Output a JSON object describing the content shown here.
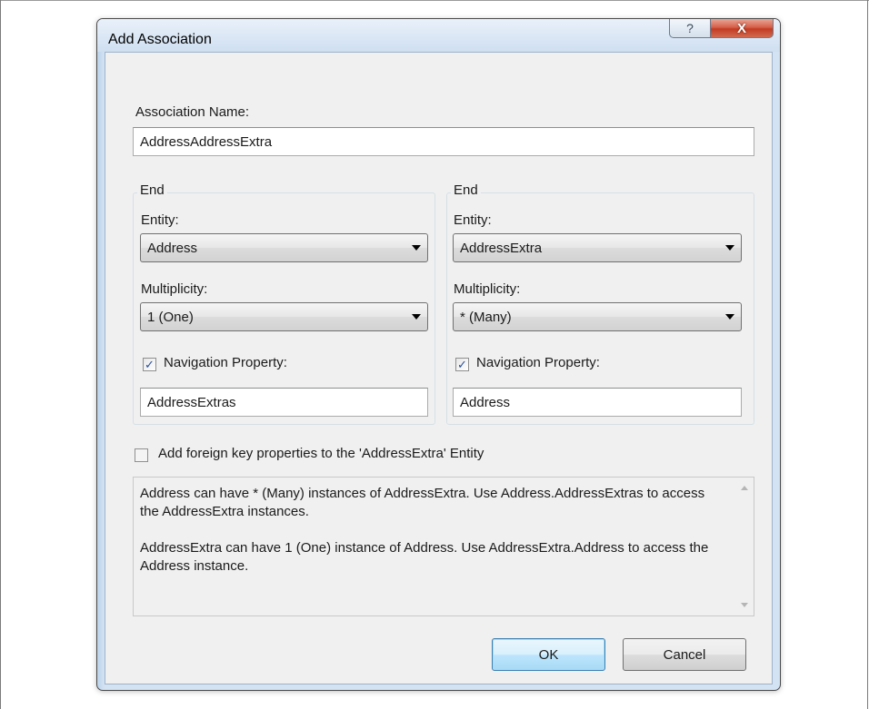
{
  "dialog": {
    "title": "Add Association",
    "help_glyph": "?",
    "close_glyph": "X"
  },
  "association_name": {
    "label": "Association Name:",
    "value": "AddressAddressExtra"
  },
  "ends": [
    {
      "legend": "End",
      "entity_label": "Entity:",
      "entity_value": "Address",
      "multiplicity_label": "Multiplicity:",
      "multiplicity_value": "1 (One)",
      "nav_checked_glyph": "✓",
      "nav_label": "Navigation Property:",
      "nav_value": "AddressExtras"
    },
    {
      "legend": "End",
      "entity_label": "Entity:",
      "entity_value": "AddressExtra",
      "multiplicity_label": "Multiplicity:",
      "multiplicity_value": "* (Many)",
      "nav_checked_glyph": "✓",
      "nav_label": "Navigation Property:",
      "nav_value": "Address"
    }
  ],
  "foreign_key": {
    "checked": false,
    "label": "Add foreign key properties to the 'AddressExtra' Entity"
  },
  "description": {
    "line1": "Address can have * (Many) instances of AddressExtra. Use Address.AddressExtras to access the AddressExtra instances.",
    "line2": "AddressExtra can have 1 (One) instance of Address. Use AddressExtra.Address to access the Address instance."
  },
  "buttons": {
    "ok": "OK",
    "cancel": "Cancel"
  },
  "icons": {
    "help": "help-icon",
    "close": "close-icon",
    "dropdown": "chevron-down-icon",
    "check": "checkmark-icon",
    "scroll_up": "scroll-up-arrow-icon",
    "scroll_down": "scroll-down-arrow-icon"
  },
  "colors": {
    "title_bar": "#dbe7f5",
    "close_button": "#c23b22",
    "default_button": "#bee6fd"
  }
}
